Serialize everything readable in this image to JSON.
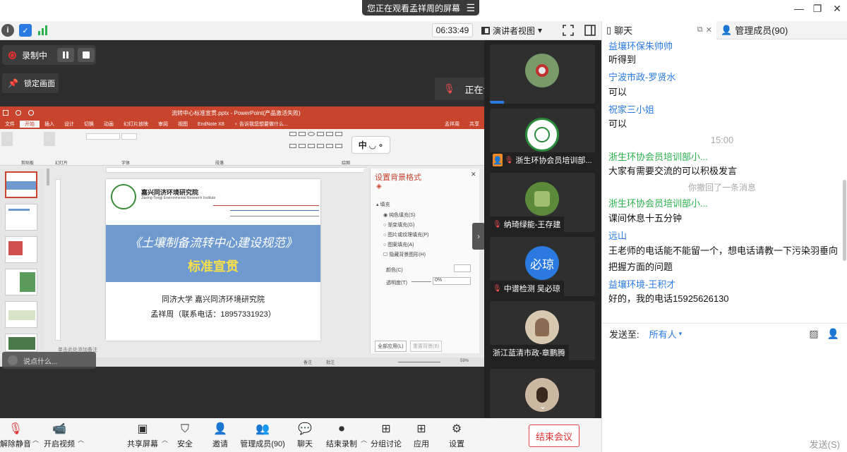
{
  "window": {
    "share_banner": "您正在观看孟祥周的屏幕",
    "minimize": "—",
    "restore": "❐",
    "close": "✕",
    "menu": "☰"
  },
  "toolbar": {
    "info": "i",
    "shield": "✓",
    "timer": "06:33:49",
    "view_label": "演讲者视图",
    "view_caret": "▾"
  },
  "stage": {
    "recording_label": "录制中",
    "lock_label": "锁定画面",
    "speaking_label": "正在讲话:",
    "float_ctl": "中 ◡ ∘",
    "hint": "说点什么..."
  },
  "ppt": {
    "title": "流转中心标准宣贯.pptx - PowerPoint(产品激活失败)",
    "tabs": [
      "文件",
      "开始",
      "插入",
      "设计",
      "切换",
      "动画",
      "幻灯片放映",
      "审阅",
      "视图",
      "EndNote X8",
      "♀ 告诉我您想要做什么..."
    ],
    "user": "孟祥周",
    "share": "共享",
    "ribbon_groups": [
      "剪贴板",
      "幻灯片",
      "字体",
      "段落",
      "绘图"
    ],
    "slide": {
      "institute": "嘉兴同济环境研究院",
      "institute_en": "Jiaxing-Tongji Environmental Research Institute",
      "title1": "《土壤制备流转中心建设规范》",
      "title2": "标准宣贯",
      "org": "同济大学  嘉兴同济环境研究院",
      "author": "孟祥周（联系电话：18957331923）"
    },
    "pane": {
      "title": "设置背景格式",
      "section": "填充",
      "options": [
        "纯色填充(S)",
        "渐变填充(G)",
        "图片或纹理填充(P)",
        "图案填充(A)",
        "隐藏背景图形(H)"
      ],
      "color_label": "颜色(C)",
      "transparency_label": "透明度(T)",
      "transparency_value": "0%",
      "apply_all": "全部应用(L)",
      "reset": "重置背景(B)"
    },
    "notes_hint": "单击此处添加备注",
    "status_notes": "备注",
    "status_comments": "批注",
    "zoom": "59%"
  },
  "tiles": [
    {
      "name": ""
    },
    {
      "name": "浙生环协会员培训部..."
    },
    {
      "name": "纳琦绿能-王存建"
    },
    {
      "name": "中谱检测 吴必琼",
      "avatar_text": "必琼"
    },
    {
      "name": "浙江蓝清市政-章鹏腾"
    },
    {
      "name": ""
    }
  ],
  "bottom": {
    "mute": "解除静音",
    "video": "开启视频",
    "share": "共享屏幕",
    "security": "安全",
    "invite": "邀请",
    "members": "管理成员(90)",
    "chat": "聊天",
    "record": "结束录制",
    "breakout": "分组讨论",
    "apps": "应用",
    "settings": "设置",
    "end": "结束会议"
  },
  "chat": {
    "tab_chat": "聊天",
    "tab_members": "管理成员(90)",
    "messages": [
      {
        "name": "益壤环保朱帅帅",
        "text": "听得到"
      },
      {
        "name": "宁波市政-罗贤水",
        "text": "可以"
      },
      {
        "name": "祝家三小姐",
        "text": "可以"
      },
      {
        "time": "15:00"
      },
      {
        "name": "浙生环协会员培训部小...",
        "text": "大家有需要交流的可以积极发言",
        "green": true
      },
      {
        "system": "你撤回了一条消息"
      },
      {
        "name": "浙生环协会员培训部小...",
        "text": "课间休息十五分钟",
        "green": true
      },
      {
        "name": "远山",
        "text": "王老师的电话能不能留一个，想电话请教一下污染羽垂向把握方面的问题"
      },
      {
        "name": "益壤环境-王积才",
        "text": "好的，我的电话15925626130"
      }
    ],
    "send_to_label": "发送至:",
    "send_to_value": "所有人",
    "send_btn": "发送(S)"
  },
  "colors": {
    "accent_red": "#e03030",
    "ppt_red": "#c8442d",
    "link_blue": "#2a7ae2",
    "green": "#2bb24c",
    "slide_band": "#6f9ad0"
  }
}
